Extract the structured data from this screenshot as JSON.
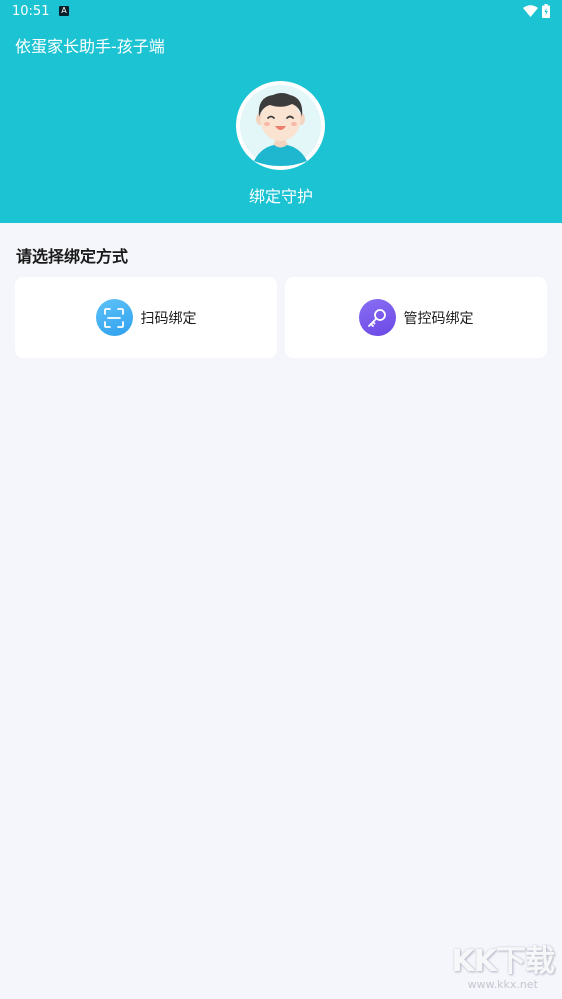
{
  "status_bar": {
    "time": "10:51",
    "notification_badge": "A"
  },
  "header": {
    "app_title": "依蛋家长助手-孩子端",
    "guard_label": "绑定守护",
    "bg_color": "#1cc3d2"
  },
  "main": {
    "section_title": "请选择绑定方式",
    "options": [
      {
        "label": "扫码绑定",
        "icon": "scan-icon"
      },
      {
        "label": "管控码绑定",
        "icon": "key-icon"
      }
    ]
  },
  "watermark": {
    "logo": "KK下载",
    "url": "www.kkx.net"
  }
}
